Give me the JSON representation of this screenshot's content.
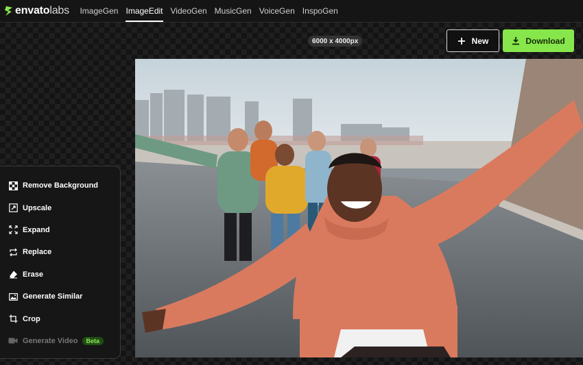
{
  "brand": {
    "name_bold": "envato",
    "name_light": "labs"
  },
  "nav": {
    "items": [
      {
        "label": "ImageGen"
      },
      {
        "label": "ImageEdit",
        "active": true
      },
      {
        "label": "VideoGen"
      },
      {
        "label": "MusicGen"
      },
      {
        "label": "VoiceGen"
      },
      {
        "label": "InspoGen"
      }
    ]
  },
  "image": {
    "dimensions": "6000 x 4000px"
  },
  "actions": {
    "new_label": "New",
    "download_label": "Download"
  },
  "tools": {
    "items": [
      {
        "label": "Remove Background",
        "icon": "checkerboard-icon"
      },
      {
        "label": "Upscale",
        "icon": "upscale-icon"
      },
      {
        "label": "Expand",
        "icon": "expand-icon"
      },
      {
        "label": "Replace",
        "icon": "replace-icon"
      },
      {
        "label": "Erase",
        "icon": "eraser-icon"
      },
      {
        "label": "Generate Similar",
        "icon": "image-icon"
      },
      {
        "label": "Crop",
        "icon": "crop-icon"
      },
      {
        "label": "Generate Video",
        "icon": "video-camera-icon",
        "disabled": true,
        "badge": "Beta"
      }
    ]
  },
  "colors": {
    "accent": "#87e64b",
    "background": "#141414",
    "panel": "#161616"
  }
}
